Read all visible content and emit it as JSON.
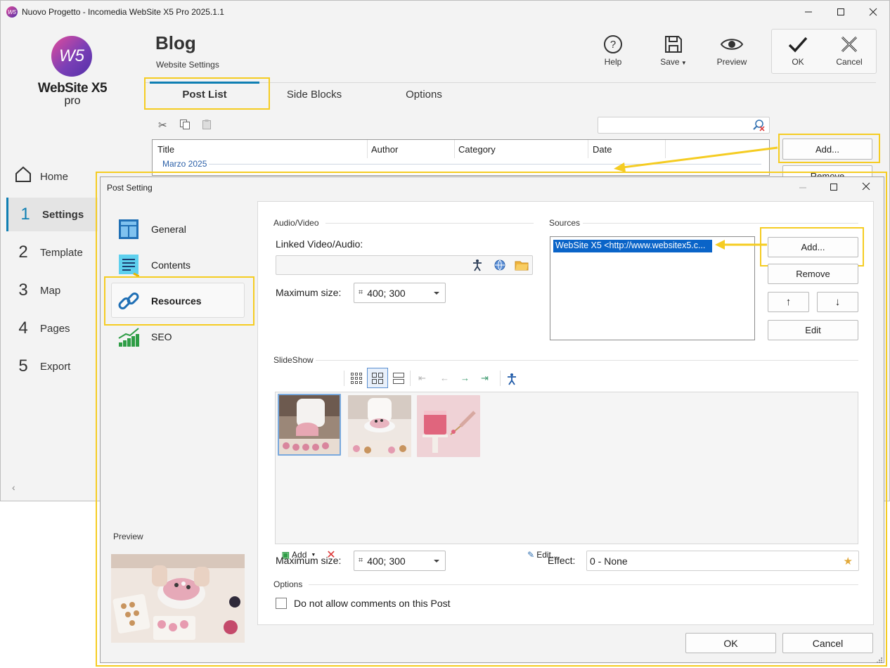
{
  "window": {
    "title": "Nuovo Progetto - Incomedia WebSite X5 Pro 2025.1.1"
  },
  "brand": {
    "logo_text": "W5",
    "line1": "WebSite X5",
    "line2": "pro"
  },
  "header": {
    "title": "Blog",
    "subtitle": "Website Settings"
  },
  "toolbar": {
    "help": "Help",
    "save": "Save",
    "preview": "Preview",
    "ok": "OK",
    "cancel": "Cancel"
  },
  "nav": [
    {
      "num": "",
      "label": "Home"
    },
    {
      "num": "1",
      "label": "Settings"
    },
    {
      "num": "2",
      "label": "Template"
    },
    {
      "num": "3",
      "label": "Map"
    },
    {
      "num": "4",
      "label": "Pages"
    },
    {
      "num": "5",
      "label": "Export"
    }
  ],
  "tabs": [
    {
      "label": "Post List"
    },
    {
      "label": "Side Blocks"
    },
    {
      "label": "Options"
    }
  ],
  "postlist": {
    "columns": [
      "Title",
      "Author",
      "Category",
      "Date"
    ],
    "group": "Marzo 2025",
    "add_button": "Add...",
    "remove_button": "Remove"
  },
  "dialog": {
    "title": "Post Setting",
    "sidebar": [
      {
        "label": "General"
      },
      {
        "label": "Contents"
      },
      {
        "label": "Resources"
      },
      {
        "label": "SEO"
      }
    ],
    "preview_label": "Preview",
    "audio_video": {
      "section": "Audio/Video",
      "linked_label": "Linked Video/Audio:",
      "linked_value": "",
      "maxsize_label": "Maximum size:",
      "maxsize_value": "400; 300"
    },
    "sources": {
      "section": "Sources",
      "items": [
        "WebSite X5  <http://www.websitex5.c..."
      ],
      "add": "Add...",
      "remove": "Remove",
      "up": "↑",
      "down": "↓",
      "edit": "Edit"
    },
    "slideshow": {
      "section": "SlideShow",
      "add": "Add",
      "edit": "Edit...",
      "maxsize_label": "Maximum size:",
      "maxsize_value": "400; 300",
      "effect_label": "Effect:",
      "effect_value": "0 - None"
    },
    "options": {
      "section": "Options",
      "no_comments": "Do not allow comments on this Post",
      "no_comments_checked": false
    },
    "ok": "OK",
    "cancel": "Cancel"
  },
  "colors": {
    "accent": "#0f7fb3",
    "highlight": "#f5cc22",
    "selection": "#0a64c8"
  }
}
